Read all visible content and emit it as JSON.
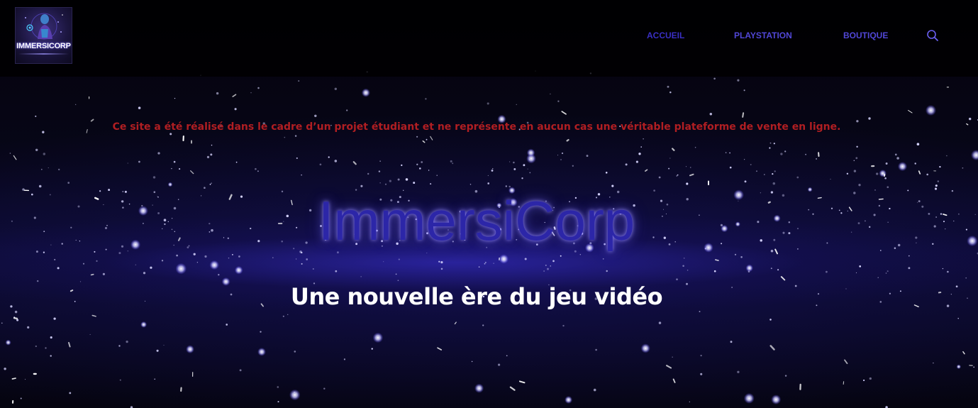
{
  "brand": {
    "logo_text": "IMMERSICORP"
  },
  "nav": {
    "items": [
      {
        "label": "ACCUEIL"
      },
      {
        "label": "PLAYSTATION"
      },
      {
        "label": "BOUTIQUE"
      }
    ],
    "search_icon": "search-icon"
  },
  "hero": {
    "disclaimer": "Ce site a été réalisé dans le cadre d’un projet étudiant et ne représente en aucun cas une véritable plateforme de vente en ligne.",
    "title": "ImmersiCorp",
    "subtitle": "Une nouvelle ère du jeu vidéo"
  },
  "colors": {
    "nav_link": "#5147d6",
    "nav_active": "#3a2fc4",
    "disclaimer": "#b01e22",
    "title": "#2c26a8",
    "subtitle": "#ffffff",
    "background": "#05040f"
  }
}
